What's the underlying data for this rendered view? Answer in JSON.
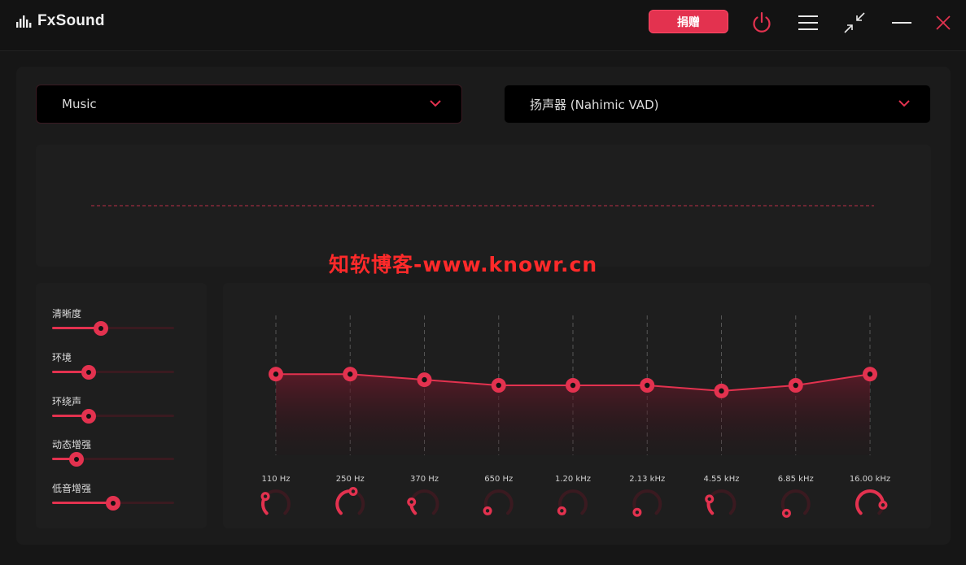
{
  "app": {
    "title": "FxSound"
  },
  "titlebar": {
    "donate_label": "捐赠",
    "icons": [
      "power-icon",
      "menu-icon",
      "collapse-icon",
      "minimize-icon",
      "close-icon"
    ]
  },
  "colors": {
    "accent": "#e3324f",
    "background": "#161616",
    "panel": "#1b1b1b"
  },
  "preset": {
    "value": "Music"
  },
  "output_device": {
    "value": "扬声器 (Nahimic VAD)"
  },
  "watermark": "知软博客-www.knowr.cn",
  "effects": [
    {
      "label": "清晰度",
      "value": 0.4
    },
    {
      "label": "环境",
      "value": 0.3
    },
    {
      "label": "环绕声",
      "value": 0.3
    },
    {
      "label": "动态增强",
      "value": 0.2
    },
    {
      "label": "低音增强",
      "value": 0.5
    }
  ],
  "eq": {
    "bands": [
      {
        "label": "110 Hz",
        "level": 0.58,
        "knob": 0.3
      },
      {
        "label": "250 Hz",
        "level": 0.58,
        "knob": 0.55
      },
      {
        "label": "370 Hz",
        "level": 0.54,
        "knob": 0.2
      },
      {
        "label": "650 Hz",
        "level": 0.5,
        "knob": 0.05
      },
      {
        "label": "1.20 kHz",
        "level": 0.5,
        "knob": 0.05
      },
      {
        "label": "2.13 kHz",
        "level": 0.5,
        "knob": 0.02
      },
      {
        "label": "4.55 kHz",
        "level": 0.46,
        "knob": 0.25
      },
      {
        "label": "6.85 kHz",
        "level": 0.5,
        "knob": 0.0
      },
      {
        "label": "16.00 kHz",
        "level": 0.58,
        "knob": 0.85
      }
    ]
  }
}
